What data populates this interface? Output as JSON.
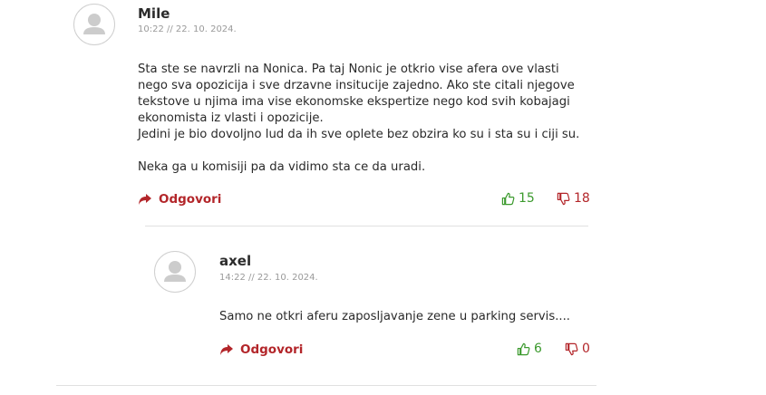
{
  "comments": [
    {
      "author": "Mile",
      "meta": "10:22 // 22. 10. 2024.",
      "paragraphs": [
        "Sta ste se navrzli na Nonica. Pa taj Nonic je otkrio vise afera ove vlasti nego sva opozicija i sve drzavne insitucije zajedno. Ako ste citali njegove tekstove u njima ima vise ekonomske ekspertize nego kod svih kobajagi ekonomista iz vlasti i opozicije.",
        "Jedini je bio dovoljno lud da ih sve oplete bez obzira ko su i sta su i ciji su.",
        "",
        "Neka ga u komisiji pa da vidimo sta ce da uradi."
      ],
      "reply_label": "Odgovori",
      "likes": "15",
      "dislikes": "18"
    },
    {
      "author": "axel",
      "meta": "14:22 // 22. 10. 2024.",
      "paragraphs": [
        "Samo ne otkri aferu zaposljavanje zene u parking servis...."
      ],
      "reply_label": "Odgovori",
      "likes": "6",
      "dislikes": "0"
    }
  ],
  "icons": {
    "avatar": "user-avatar-icon",
    "reply": "share-arrow-icon",
    "like": "thumbs-up-icon",
    "dislike": "thumbs-down-icon"
  },
  "colors": {
    "accent_red": "#b3262a",
    "like_green": "#3c9a2e",
    "meta_gray": "#9a9a9a"
  }
}
